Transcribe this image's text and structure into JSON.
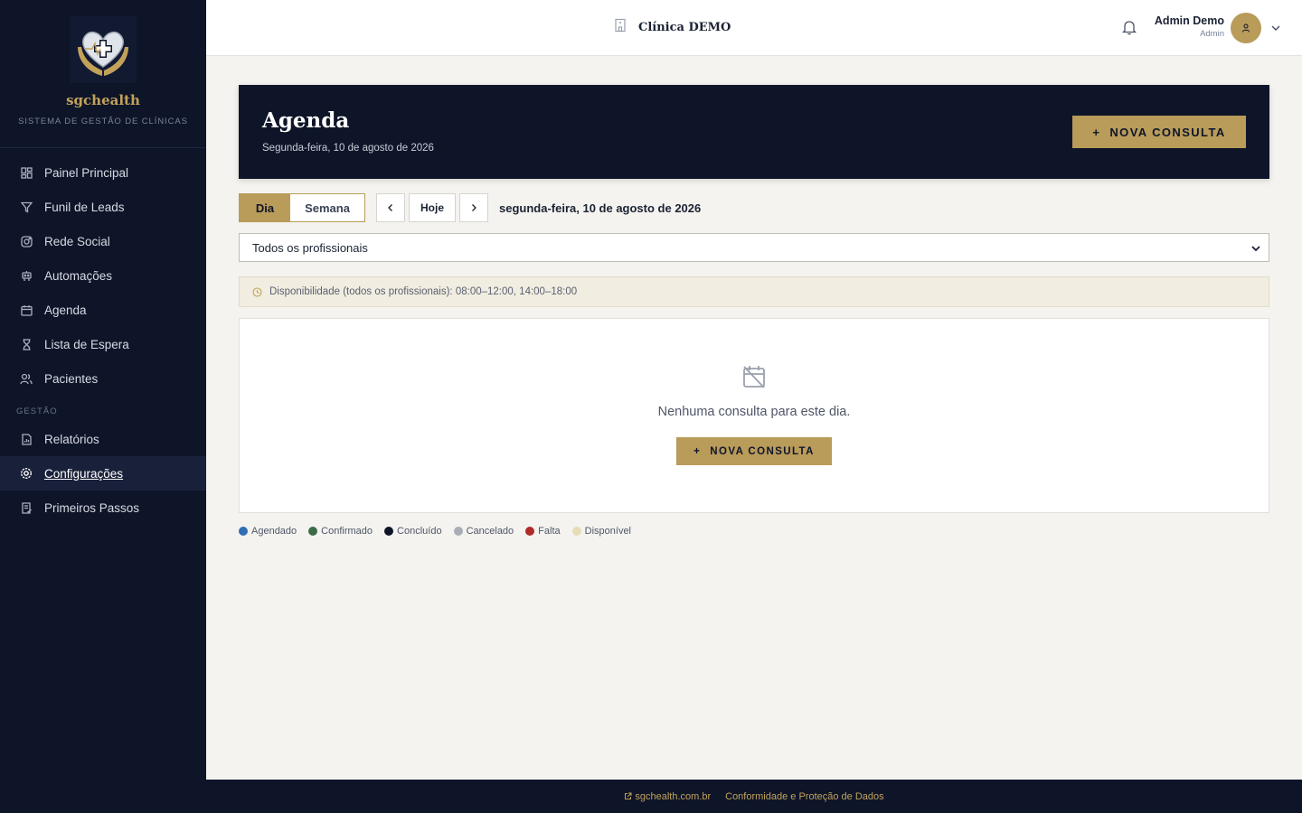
{
  "sidebar": {
    "brand_name": "sgchealth",
    "brand_subtitle": "SISTEMA DE GESTÃO DE CLÍNICAS",
    "items": [
      {
        "label": "Painel Principal",
        "icon": "dashboard-icon"
      },
      {
        "label": "Funil de Leads",
        "icon": "funnel-icon"
      },
      {
        "label": "Rede Social",
        "icon": "instagram-icon"
      },
      {
        "label": "Automações",
        "icon": "bot-icon"
      },
      {
        "label": "Agenda",
        "icon": "calendar-icon"
      },
      {
        "label": "Lista de Espera",
        "icon": "hourglass-icon"
      },
      {
        "label": "Pacientes",
        "icon": "users-icon"
      }
    ],
    "section_label": "GESTÃO",
    "section_items": [
      {
        "label": "Relatórios",
        "icon": "report-icon"
      },
      {
        "label": "Configurações",
        "icon": "gear-icon",
        "active": true
      },
      {
        "label": "Primeiros Passos",
        "icon": "checklist-icon"
      }
    ]
  },
  "topbar": {
    "clinic_name": "Clínica DEMO",
    "user_name": "Admin Demo",
    "user_role": "Admin"
  },
  "hero": {
    "title": "Agenda",
    "subtitle": "Segunda-feira, 10 de agosto de 2026",
    "button_label": "NOVA CONSULTA"
  },
  "controls": {
    "view_day": "Dia",
    "view_week": "Semana",
    "today": "Hoje",
    "current_date": "segunda-feira, 10 de agosto de 2026"
  },
  "filter": {
    "selected": "Todos os profissionais"
  },
  "availability": {
    "text": "Disponibilidade (todos os profissionais): 08:00–12:00, 14:00–18:00"
  },
  "empty_state": {
    "message": "Nenhuma consulta para este dia.",
    "button_label": "NOVA CONSULTA"
  },
  "legend": [
    {
      "label": "Agendado",
      "color": "#2f6db5"
    },
    {
      "label": "Confirmado",
      "color": "#3d6b45"
    },
    {
      "label": "Concluído",
      "color": "#0e1529"
    },
    {
      "label": "Cancelado",
      "color": "#a9adb8"
    },
    {
      "label": "Falta",
      "color": "#b02a2a"
    },
    {
      "label": "Disponível",
      "color": "#e8dcb6"
    }
  ],
  "footer": {
    "site_link": "sgchealth.com.br",
    "compliance_link": "Conformidade e Proteção de Dados"
  },
  "colors": {
    "navy": "#0e1529",
    "gold": "#b99b5a",
    "background": "#f4f3ef"
  }
}
